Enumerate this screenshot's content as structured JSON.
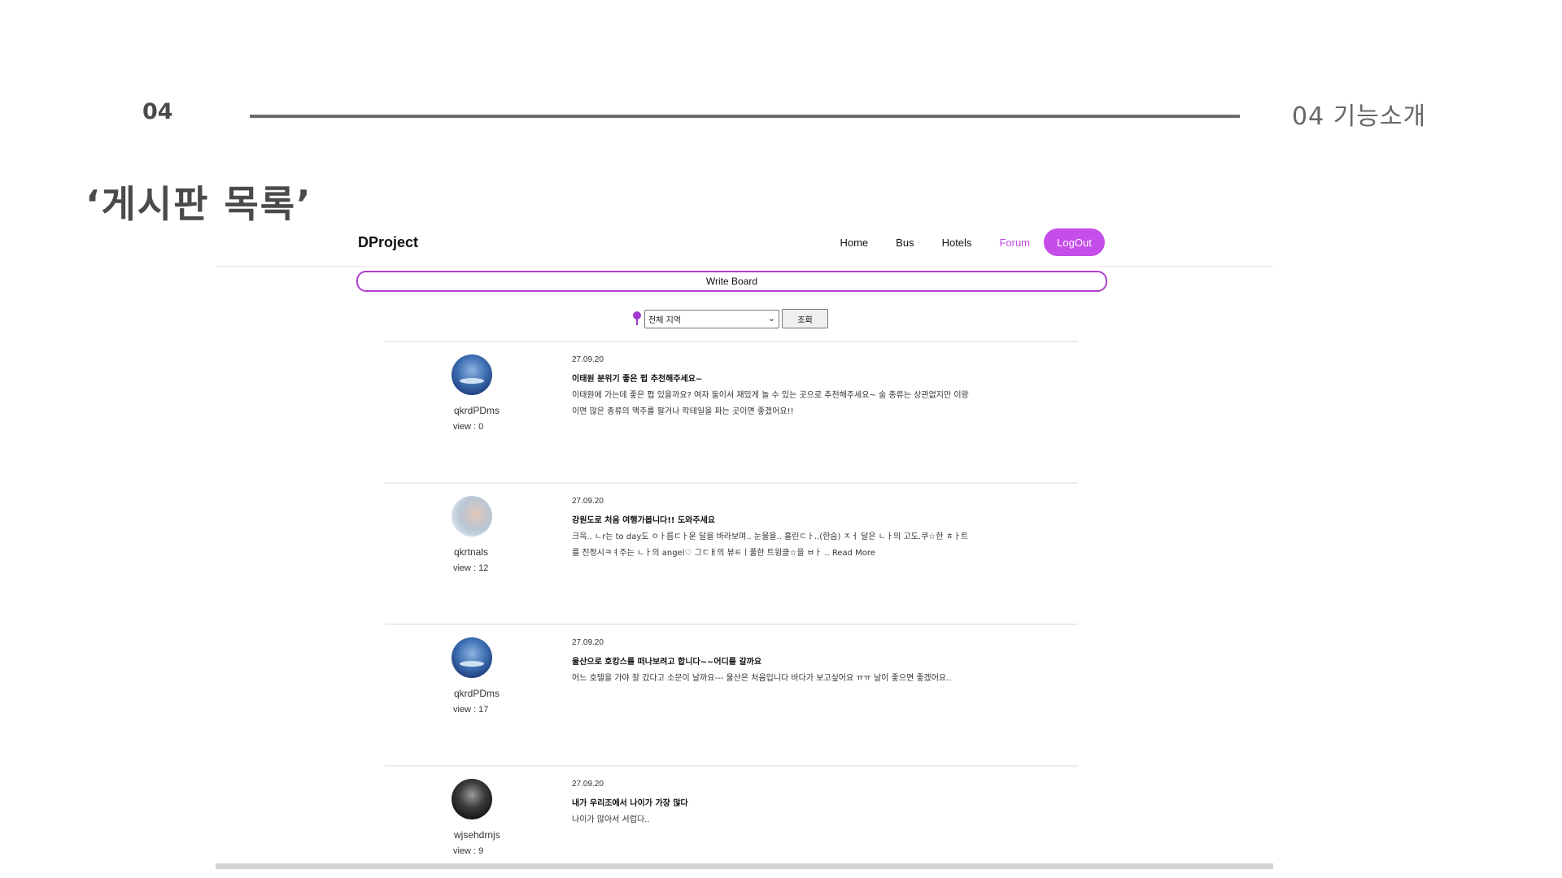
{
  "slide": {
    "number": "04",
    "section": "04  기능소개",
    "title": "‘게시판 목록’"
  },
  "site": {
    "brand": "DProject",
    "nav": [
      {
        "label": "Home",
        "active": false
      },
      {
        "label": "Bus",
        "active": false
      },
      {
        "label": "Hotels",
        "active": false
      },
      {
        "label": "Forum",
        "active": true
      }
    ],
    "logout_label": "LogOut",
    "write_board_label": "Write Board",
    "filter": {
      "region_selected": "전체 지역",
      "search_label": "조회"
    },
    "posts": [
      {
        "author": "qkrdPDms",
        "views": "view : 0",
        "date": "27.09.20",
        "title": "이태원 분위기 좋은 펍 추천해주세요~",
        "body": "이태원에 가는데 좋은 펍 있을까요? 여자 둘이서 재밌게 놀 수 있는 곳으로 추천해주세요~ 술 종류는 상관없지만 이왕이면 많은 종류의 맥주를 팔거나 칵테일을 파는 곳이면 좋겠어요!!",
        "avatar": "sky"
      },
      {
        "author": "qkrtnals",
        "views": "view : 12",
        "date": "27.09.20",
        "title": "강원도로 처음 여행가봅니다!! 도와주세요",
        "body": "크윽.. ㄴr는 to day도 ㅇㅏ름ㄷㅏ운 달을 바라보며.. 눈물을.. 흘린ㄷㅏ..(한숨) ㅈㅓ 달은 ㄴㅏ의 고도.쿠☆한 ㅎㅏ트를 진정시ㅋㅕ주는 ㄴㅏ의 angel♡ 그ㄷㅐ의 뷰ㅌㅣ풀한 트윙클☆을 ㅂㅏ .. Read More",
        "avatar": "pale"
      },
      {
        "author": "qkrdPDms",
        "views": "view : 17",
        "date": "27.09.20",
        "title": "울산으로 호캉스를 떠나보려고 합니다~~어디를 갈까요",
        "body": "어느 호텔을 가야 잘 갔다고 소문이 날까요--- 울산은 처음입니다 바다가 보고싶어요 ㅠㅠ 날이 좋으면 좋겠어요..",
        "avatar": "sky"
      },
      {
        "author": "wjsehdrnjs",
        "views": "view : 9",
        "date": "27.09.20",
        "title": "내가 우리조에서 나이가 가장 많다",
        "body": "나이가 많아서 서럽다..",
        "avatar": "dark"
      }
    ]
  }
}
